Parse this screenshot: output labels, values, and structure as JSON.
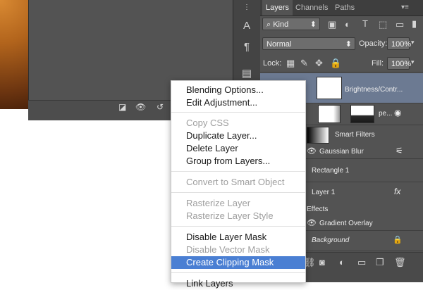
{
  "layers_panel": {
    "tabs": [
      {
        "label": "Layers",
        "active": true
      },
      {
        "label": "Channels",
        "active": false
      },
      {
        "label": "Paths",
        "active": false
      }
    ],
    "filter_kind": "Kind",
    "blend_mode": "Normal",
    "opacity_label": "Opacity:",
    "opacity_value": "100%",
    "lock_label": "Lock:",
    "fill_label": "Fill:",
    "fill_value": "100%",
    "layers": [
      {
        "name": "Brightness/Contr...",
        "selected": true
      },
      {
        "name": "pe..."
      },
      {
        "name": "Smart Filters"
      },
      {
        "name": "Gaussian Blur"
      },
      {
        "name": "Rectangle 1"
      },
      {
        "name": "Layer 1",
        "fx": "fx"
      },
      {
        "name": "Effects"
      },
      {
        "name": "Gradient Overlay"
      },
      {
        "name": "Background"
      }
    ]
  },
  "context_menu": {
    "items": [
      {
        "label": "Blending Options...",
        "disabled": false
      },
      {
        "label": "Edit Adjustment...",
        "disabled": false
      },
      {
        "label": "Copy CSS",
        "disabled": true
      },
      {
        "label": "Duplicate Layer...",
        "disabled": false
      },
      {
        "label": "Delete Layer",
        "disabled": false
      },
      {
        "label": "Group from Layers...",
        "disabled": false
      },
      {
        "label": "Convert to Smart Object",
        "disabled": true
      },
      {
        "label": "Rasterize Layer",
        "disabled": true
      },
      {
        "label": "Rasterize Layer Style",
        "disabled": true
      },
      {
        "label": "Disable Layer Mask",
        "disabled": false
      },
      {
        "label": "Disable Vector Mask",
        "disabled": true
      },
      {
        "label": "Create Clipping Mask",
        "disabled": false,
        "highlighted": true
      },
      {
        "label": "Link Layers",
        "disabled": false
      }
    ]
  },
  "colors": {
    "panel_bg": "#535353",
    "selected_layer": "#6c7a92",
    "menu_highlight": "#4a7fd3"
  }
}
